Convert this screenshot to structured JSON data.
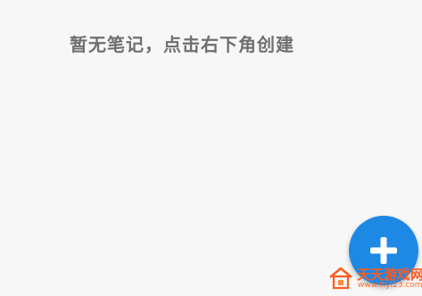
{
  "empty_state": {
    "message": "暂无笔记，点击右下角创建"
  },
  "fab": {
    "icon": "plus-icon",
    "color": "#1e88e5"
  },
  "watermark": {
    "title": "天天游戏网",
    "url": "www.ttyl23.com",
    "color": "#ff5a1f"
  }
}
